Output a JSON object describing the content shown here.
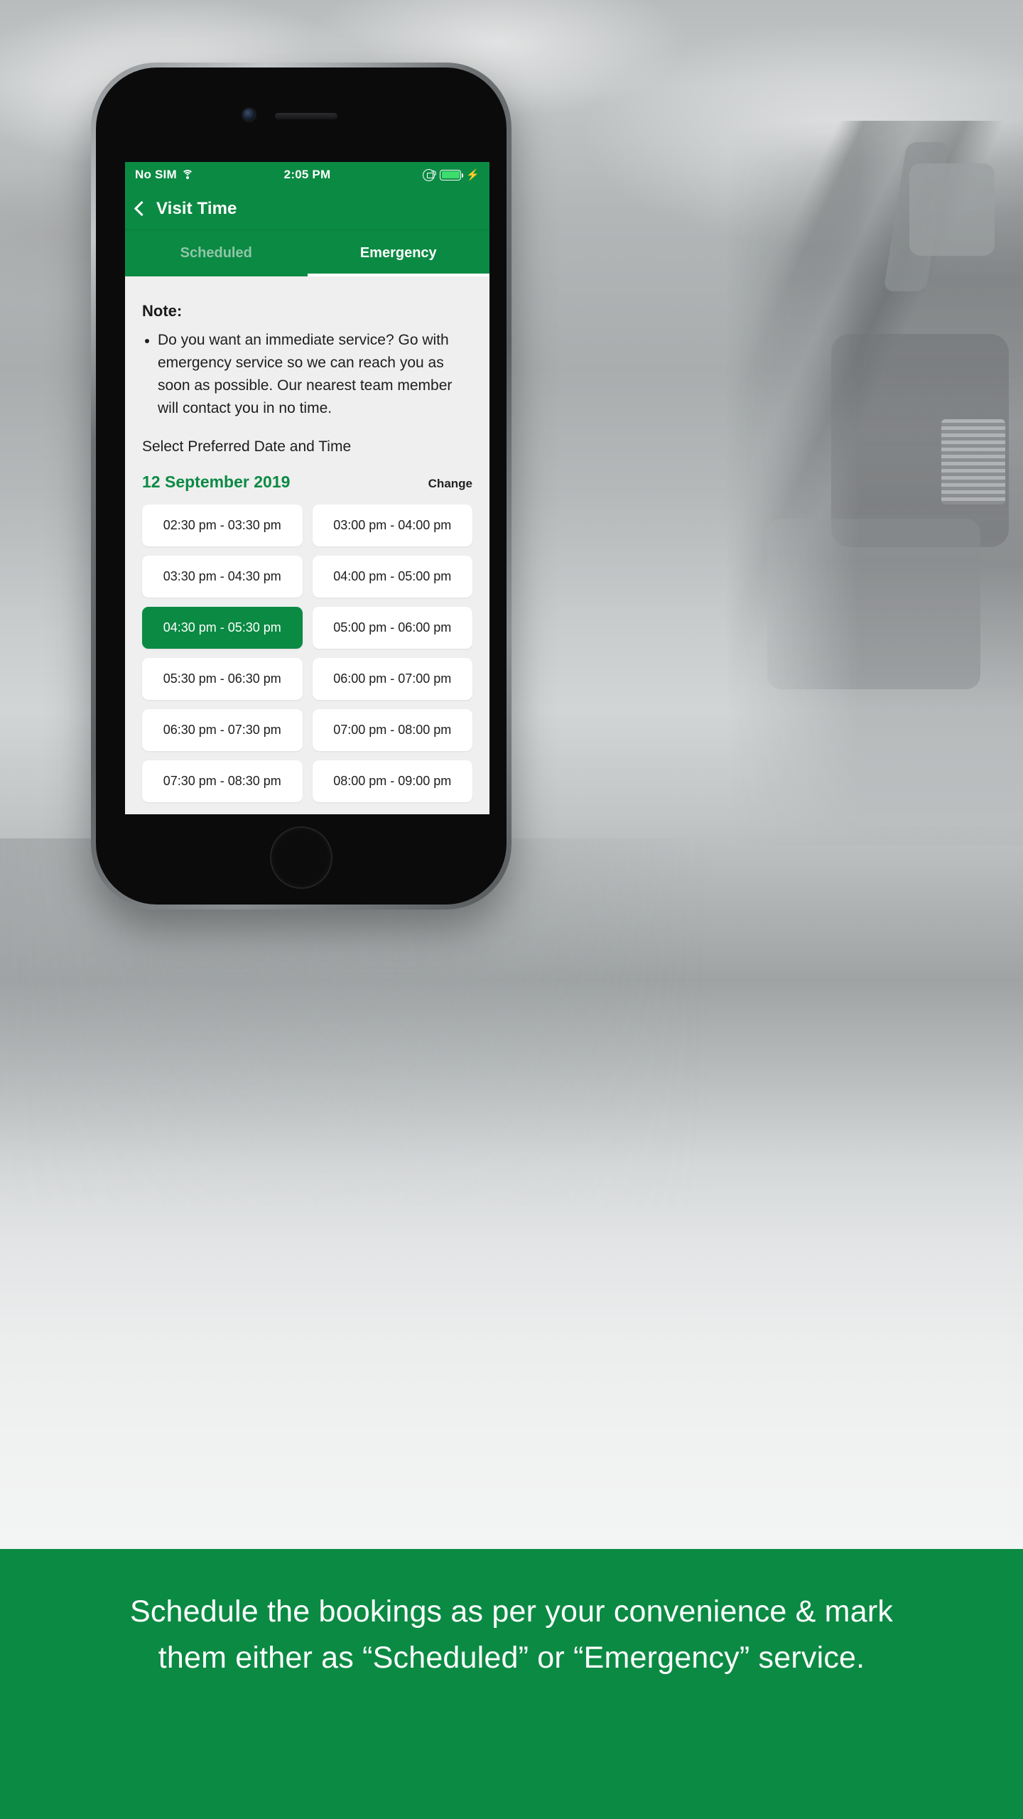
{
  "status_bar": {
    "carrier": "No SIM",
    "wifi_icon": "wifi-icon",
    "time": "2:05 PM",
    "rotation_lock_icon": "rotation-lock-icon",
    "battery_icon": "battery-icon",
    "charging_icon": "⚡"
  },
  "nav": {
    "back_icon": "back-chevron-icon",
    "title": "Visit Time"
  },
  "tabs": [
    {
      "label": "Scheduled",
      "active": false
    },
    {
      "label": "Emergency",
      "active": true
    }
  ],
  "content": {
    "note_title": "Note:",
    "note_bullets": [
      "Do you want an immediate service? Go with emergency service so we can reach you as soon as possible. Our nearest team member will contact you in no time."
    ],
    "select_label": "Select Preferred Date and Time",
    "date_value": "12 September 2019",
    "change_label": "Change",
    "slots": [
      {
        "label": "02:30 pm - 03:30 pm",
        "selected": false
      },
      {
        "label": "03:00 pm - 04:00 pm",
        "selected": false
      },
      {
        "label": "03:30 pm - 04:30 pm",
        "selected": false
      },
      {
        "label": "04:00 pm - 05:00 pm",
        "selected": false
      },
      {
        "label": "04:30 pm - 05:30 pm",
        "selected": true
      },
      {
        "label": "05:00 pm - 06:00 pm",
        "selected": false
      },
      {
        "label": "05:30 pm - 06:30 pm",
        "selected": false
      },
      {
        "label": "06:00 pm - 07:00 pm",
        "selected": false
      },
      {
        "label": "06:30 pm - 07:30 pm",
        "selected": false
      },
      {
        "label": "07:00 pm - 08:00 pm",
        "selected": false
      },
      {
        "label": "07:30 pm - 08:30 pm",
        "selected": false
      },
      {
        "label": "08:00 pm - 09:00 pm",
        "selected": false
      }
    ]
  },
  "caption": {
    "text": "Schedule the bookings as per your convenience & mark them either as “Scheduled” or “Emergency” service."
  },
  "colors": {
    "brand_green": "#0b8a43",
    "screen_bg": "#efefef",
    "slot_bg": "#ffffff",
    "inactive_tab": "#8fc6a8"
  }
}
